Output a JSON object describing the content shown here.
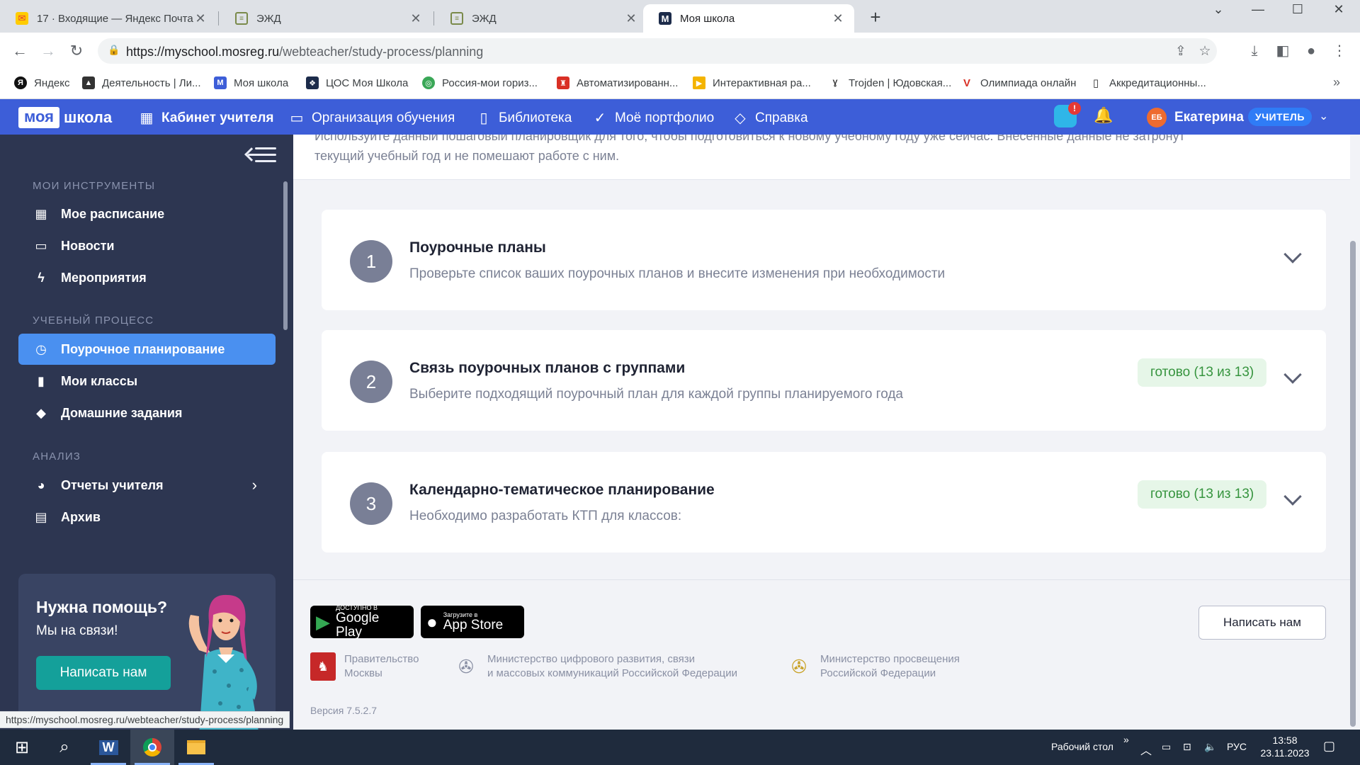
{
  "browser": {
    "tabs": [
      {
        "title": "17 · Входящие — Яндекс Почта",
        "favicon": "yandex-mail-icon"
      },
      {
        "title": "ЭЖД",
        "favicon": "document-icon"
      },
      {
        "title": "ЭЖД",
        "favicon": "document-icon"
      },
      {
        "title": "Моя школа",
        "favicon": "myschool-icon",
        "favicon_letter": "M"
      }
    ],
    "url_domain": "https://myschool.mosreg.ru",
    "url_path": "/webteacher/study-process/planning",
    "bookmarks": [
      "Яндекс",
      "Деятельность | Ли...",
      "Моя школа",
      "ЦОС Моя Школа",
      "Россия-мои гориз...",
      "Автоматизированн...",
      "Интерактивная ра...",
      "Trojden | Юдовская...",
      "Олимпиада онлайн",
      "Аккредитационны..."
    ]
  },
  "header": {
    "logo_part1": "моя",
    "logo_part2": "школа",
    "nav": [
      {
        "label": "Кабинет учителя",
        "icon": "grid-icon"
      },
      {
        "label": "Организация обучения",
        "icon": "screen-icon"
      },
      {
        "label": "Библиотека",
        "icon": "bookmark-icon"
      },
      {
        "label": "Моё портфолио",
        "icon": "check-circle-icon"
      },
      {
        "label": "Справка",
        "icon": "diamond-icon"
      }
    ],
    "chat_badge": "!",
    "avatar_initials": "ЕБ",
    "user_name": "Екатерина",
    "role": "УЧИТЕЛЬ"
  },
  "sidebar": {
    "sections": [
      {
        "title": "МОИ ИНСТРУМЕНТЫ",
        "items": [
          {
            "label": "Мое расписание",
            "icon": "calendar-icon"
          },
          {
            "label": "Новости",
            "icon": "news-icon"
          },
          {
            "label": "Мероприятия",
            "icon": "lightning-icon"
          }
        ]
      },
      {
        "title": "УЧЕБНЫЙ ПРОЦЕСС",
        "items": [
          {
            "label": "Поурочное планирование",
            "icon": "clock-icon",
            "active": true
          },
          {
            "label": "Мои классы",
            "icon": "book-icon"
          },
          {
            "label": "Домашние задания",
            "icon": "graduation-cap-icon"
          }
        ]
      },
      {
        "title": "АНАЛИЗ",
        "items": [
          {
            "label": "Отчеты учителя",
            "icon": "pie-chart-icon",
            "has_submenu": true
          },
          {
            "label": "Архив",
            "icon": "archive-icon"
          }
        ]
      }
    ],
    "help": {
      "title": "Нужна помощь?",
      "subtitle": "Мы на связи!",
      "button": "Написать нам"
    }
  },
  "main": {
    "intro_line1": "Используйте данный пошаговый планировщик для того, чтобы подготовиться к новому учебному году уже сейчас. Внесенные данные не затронут",
    "intro_line2": "текущий учебный год и не помешают работе с ним.",
    "steps": [
      {
        "number": "1",
        "title": "Поурочные планы",
        "description": "Проверьте список ваших поурочных планов и внесите изменения при необходимости",
        "status": ""
      },
      {
        "number": "2",
        "title": "Связь поурочных планов с группами",
        "description": "Выберите подходящий поурочный план для каждой группы планируемого года",
        "status": "готово (13 из 13)"
      },
      {
        "number": "3",
        "title": "Календарно-тематическое планирование",
        "description": "Необходимо разработать КТП для классов:",
        "status": "готово (13 из 13)"
      }
    ]
  },
  "footer": {
    "google_play_small": "ДОСТУПНО В",
    "google_play_big": "Google Play",
    "app_store_small": "Загрузите в",
    "app_store_big": "App Store",
    "contact_button": "Написать нам",
    "orgs": [
      {
        "line1": "Правительство",
        "line2": "Москвы"
      },
      {
        "line1": "Министерство цифрового развития, связи",
        "line2": "и массовых коммуникаций Российской Федерации"
      },
      {
        "line1": "Министерство просвещения",
        "line2": "Российской Федерации"
      }
    ],
    "version": "Версия 7.5.2.7"
  },
  "status_url": "https://myschool.mosreg.ru/webteacher/study-process/planning",
  "taskbar": {
    "desktop_label": "Рабочий стол",
    "language": "РУС",
    "time": "13:58",
    "date": "23.11.2023"
  },
  "colors": {
    "header_blue": "#3d5ed8",
    "sidebar_bg": "#2d3651",
    "active_item": "#4a90f0",
    "done_badge_bg": "#e6f6e8",
    "done_badge_text": "#36943e",
    "help_button": "#14a09a"
  }
}
